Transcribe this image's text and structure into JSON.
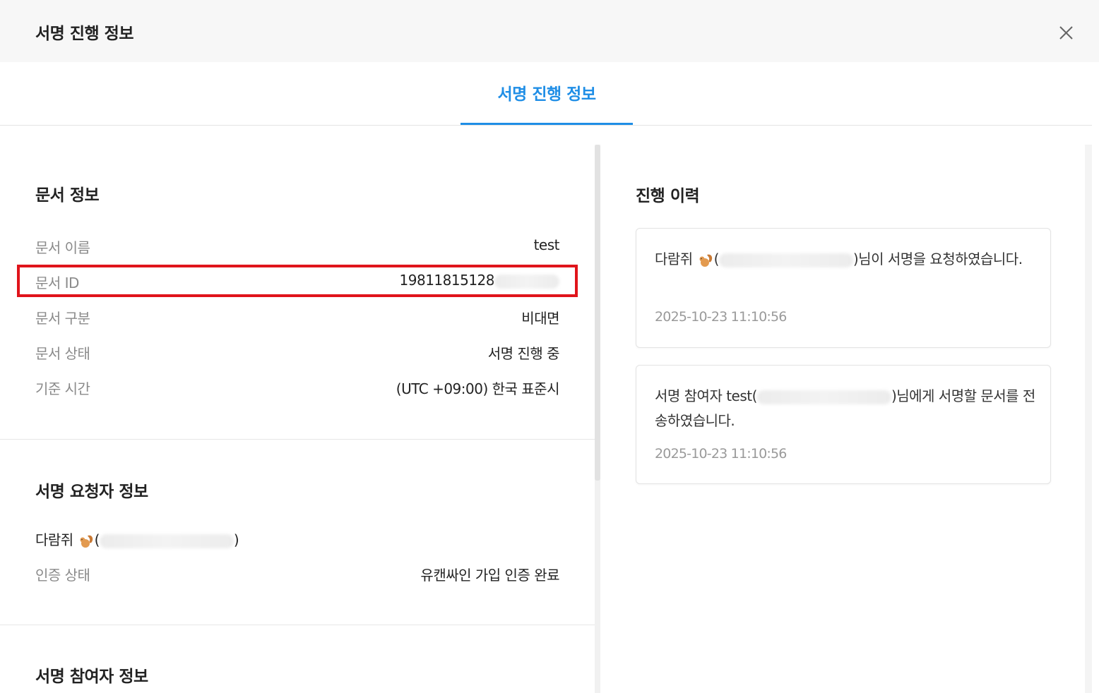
{
  "header": {
    "title": "서명 진행 정보"
  },
  "tabs": [
    {
      "label": "서명 진행 정보",
      "active": true
    }
  ],
  "accent_color": "#1f8ee6",
  "highlight_color": "#e0141b",
  "document_info": {
    "title": "문서 정보",
    "rows": [
      {
        "label": "문서 이름",
        "value": "test"
      },
      {
        "label": "문서 ID",
        "value": "19811815128"
      },
      {
        "label": "문서 구분",
        "value": "비대면"
      },
      {
        "label": "문서 상태",
        "value": "서명 진행 중"
      },
      {
        "label": "기준 시간",
        "value": "(UTC +09:00) 한국 표준시"
      }
    ]
  },
  "requester_info": {
    "title": "서명 요청자 정보",
    "name": "다람쥐",
    "paren_open": "(",
    "paren_close": ")",
    "auth_label": "인증 상태",
    "auth_value": "유캔싸인 가입 인증 완료"
  },
  "participant_info": {
    "title": "서명 참여자 정보"
  },
  "history": {
    "title": "진행 이력",
    "items": [
      {
        "prefix": "다람쥐",
        "paren_open": "(",
        "suffix": ")님이 서명을 요청하였습니다.",
        "time": "2025-10-23 11:10:56"
      },
      {
        "prefix": "서명 참여자 test(",
        "suffix": ")님에게 서명할 문서를 전송하였습니다.",
        "time": "2025-10-23 11:10:56"
      }
    ]
  },
  "icons": {
    "close": "close-icon",
    "squirrel": "squirrel-emoji-icon"
  }
}
